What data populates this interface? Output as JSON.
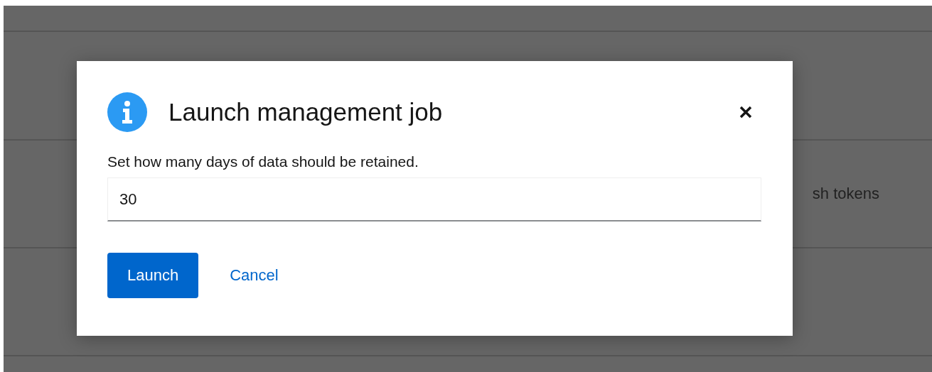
{
  "background": {
    "rows": [
      {},
      {},
      {
        "text": "sh tokens"
      },
      {}
    ]
  },
  "modal": {
    "title": "Launch management job",
    "label": "Set how many days of data should be retained.",
    "input": {
      "value": "30"
    },
    "buttons": [
      {
        "kind": "primary",
        "label": "Launch"
      },
      {
        "kind": "link",
        "label": "Cancel"
      }
    ]
  }
}
